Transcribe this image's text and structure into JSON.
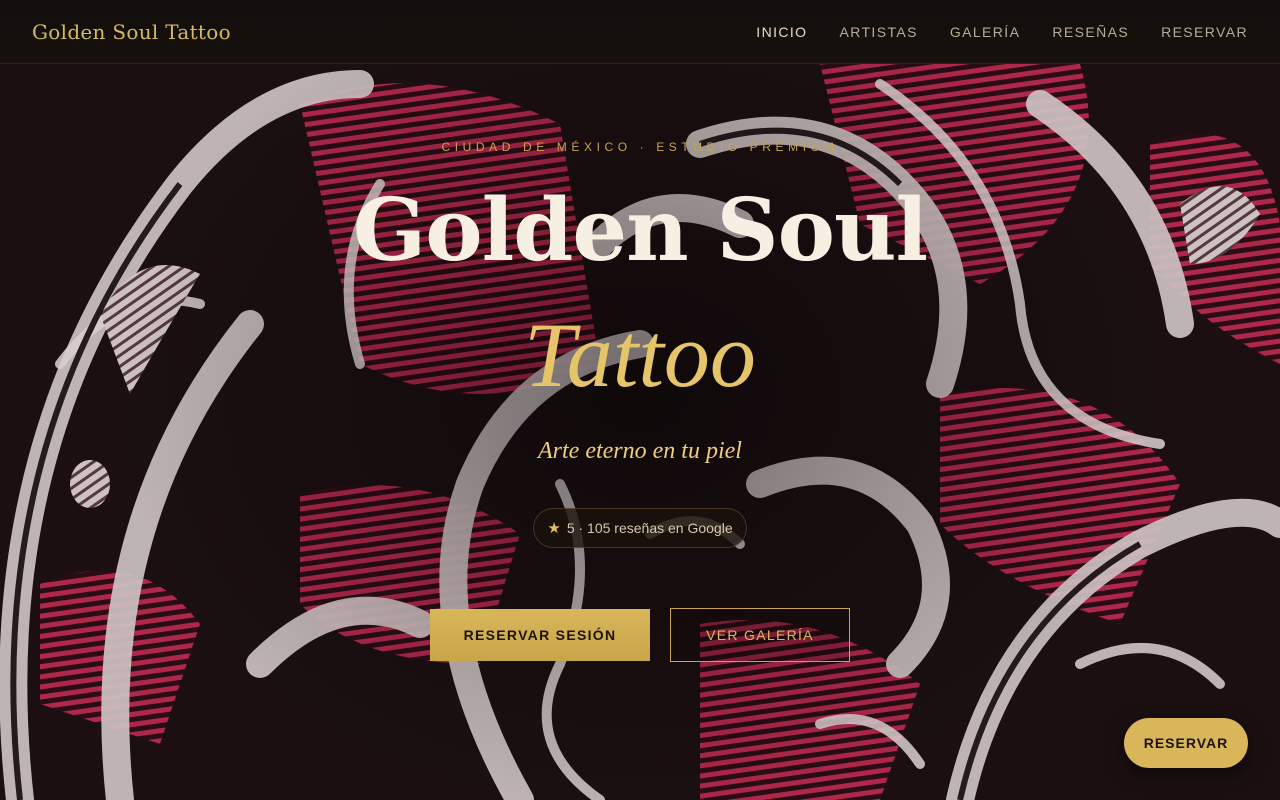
{
  "brand": {
    "name": "Golden Soul Tattoo"
  },
  "nav": {
    "items": [
      {
        "label": "INICIO",
        "active": true
      },
      {
        "label": "ARTISTAS",
        "active": false
      },
      {
        "label": "GALERÍA",
        "active": false
      },
      {
        "label": "RESEÑAS",
        "active": false
      },
      {
        "label": "RESERVAR",
        "active": false
      }
    ]
  },
  "hero": {
    "eyebrow": "CIUDAD DE MÉXICO · ESTUDIO PREMIUM",
    "title_line_1": "Golden Soul",
    "title_line_2": "Tattoo",
    "tagline": "Arte eterno en tu piel",
    "rating": {
      "star": "★",
      "text": "5 · 105 reseñas en Google"
    },
    "primary_button": "RESERVAR SESIÓN",
    "secondary_button": "VER GALERÍA"
  },
  "floating": {
    "button": "RESERVAR"
  },
  "colors": {
    "gold": "#d8b659",
    "gold_text": "#e6c46a",
    "dark": "#120e0b",
    "art_red": "#b8294d",
    "art_cream": "#d9cfcf"
  },
  "icons": {
    "rating": "star-icon"
  }
}
